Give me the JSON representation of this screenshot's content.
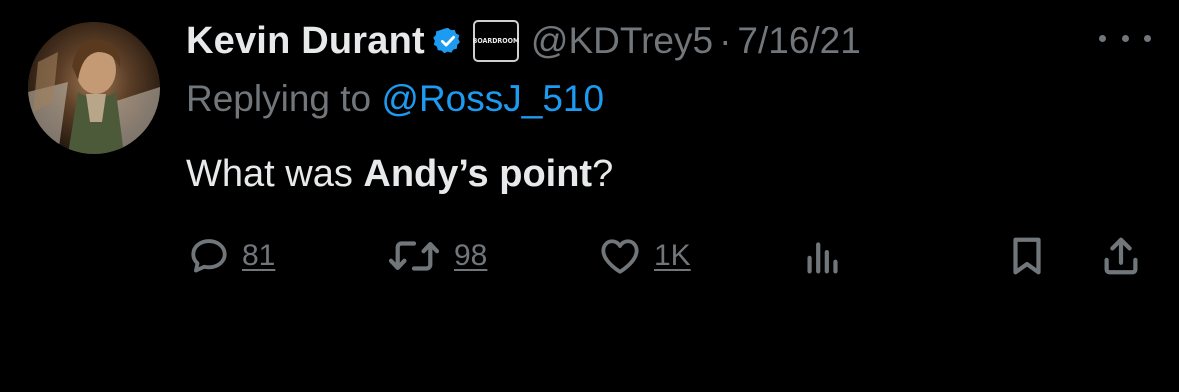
{
  "tweet": {
    "author_name": "Kevin Durant",
    "affiliate_badge_text": "BOARDROOM",
    "handle": "@KDTrey5",
    "separator": "·",
    "date": "7/16/21",
    "replying_prefix": "Replying to ",
    "replying_to": "@RossJ_510",
    "text_part1": "What was ",
    "text_bold": "Andy’s point",
    "text_part2": "?"
  },
  "actions": {
    "replies": "81",
    "retweets": "98",
    "likes": "1K"
  },
  "icons": {
    "verified": "verified-badge-icon",
    "reply": "reply-icon",
    "retweet": "retweet-icon",
    "like": "heart-icon",
    "views": "analytics-icon",
    "bookmark": "bookmark-icon",
    "share": "share-icon",
    "more": "more-icon"
  },
  "colors": {
    "background": "#000000",
    "text": "#e7e9ea",
    "muted": "#71767b",
    "link": "#1d9bf0",
    "verified": "#1d9bf0"
  }
}
